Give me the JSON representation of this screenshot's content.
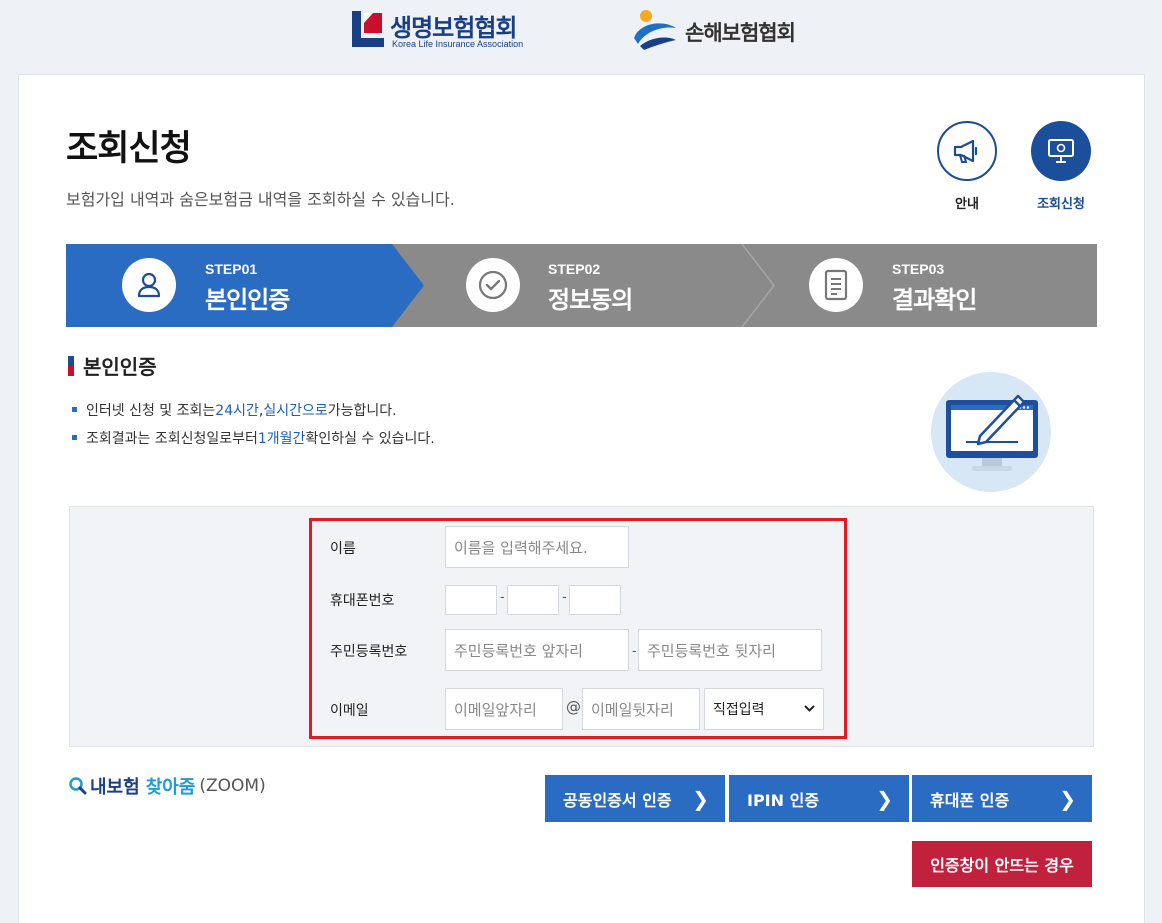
{
  "logos": {
    "klia_title": "생명보험협회",
    "klia_sub": "Korea Life Insurance Association",
    "gnia_title": "손해보험협회"
  },
  "page": {
    "title": "조회신청",
    "description": "보험가입 내역과 숨은보험금 내역을 조회하실 수 있습니다."
  },
  "top_buttons": {
    "notice": "안내",
    "inquiry": "조회신청"
  },
  "steps": [
    {
      "num": "STEP01",
      "name": "본인인증",
      "active": true
    },
    {
      "num": "STEP02",
      "name": "정보동의",
      "active": false
    },
    {
      "num": "STEP03",
      "name": "결과확인",
      "active": false
    }
  ],
  "section": {
    "title": "본인인증",
    "note1": {
      "a": "인터넷 신청 및 조회는 ",
      "b": "24시간",
      "c": ", ",
      "d": "실시간으로",
      "e": " 가능합니다."
    },
    "note2": {
      "a": "조회결과는 조회신청일로부터 ",
      "b": "1개월간",
      "c": " 확인하실 수 있습니다."
    }
  },
  "form": {
    "name_label": "이름",
    "name_placeholder": "이름을 입력해주세요.",
    "phone_label": "휴대폰번호",
    "phone_sep": "-",
    "rrn_label": "주민등록번호",
    "rrn_front_placeholder": "주민등록번호 앞자리",
    "rrn_back_placeholder": "주민등록번호 뒷자리",
    "rrn_sep": "-",
    "email_label": "이메일",
    "email_front_placeholder": "이메일앞자리",
    "email_at": "@",
    "email_back_placeholder": "이메일뒷자리",
    "email_domain_selected": "직접입력"
  },
  "zoom": {
    "part1": "내보험",
    "part2": "찾아줌",
    "part3": "(ZOOM)"
  },
  "auth": {
    "cert": "공동인증서 인증",
    "ipin": "IPIN 인증",
    "phone": "휴대폰 인증",
    "chevron": "❯",
    "fail": "인증창이 안뜨는 경우"
  },
  "colors": {
    "primary_blue": "#2a6cc2",
    "navy": "#1a4d94",
    "step_gray": "#8a8a8a",
    "highlight_red": "#e21b23",
    "fail_red": "#c2213d"
  }
}
